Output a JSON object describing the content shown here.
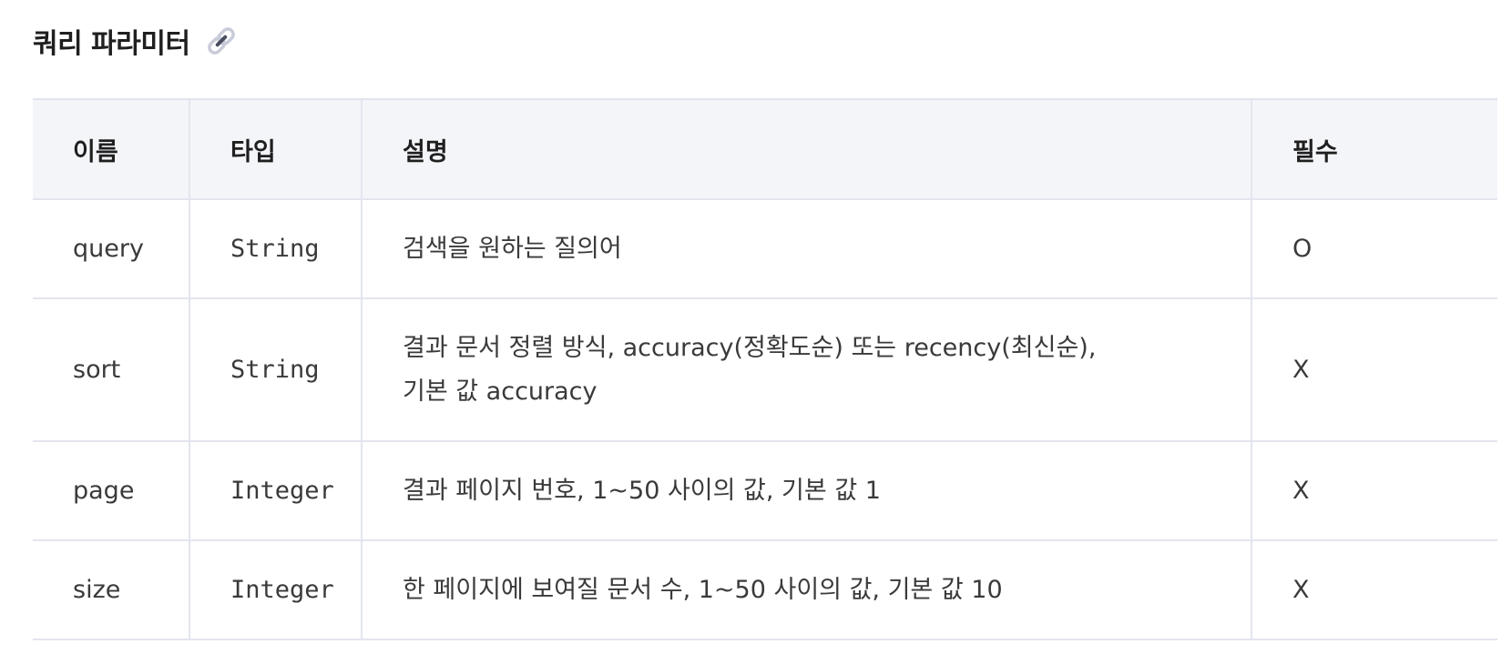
{
  "section": {
    "title": "쿼리 파라미터",
    "icon": "link-icon"
  },
  "table": {
    "headers": {
      "name": "이름",
      "type": "타입",
      "description": "설명",
      "required": "필수"
    },
    "rows": [
      {
        "name": "query",
        "type": "String",
        "description": "검색을 원하는 질의어",
        "required": "O"
      },
      {
        "name": "sort",
        "type": "String",
        "description": "결과 문서 정렬 방식, accuracy(정확도순) 또는 recency(최신순), 기본 값 accuracy",
        "required": "X"
      },
      {
        "name": "page",
        "type": "Integer",
        "description": "결과 페이지 번호, 1~50 사이의 값, 기본 값 1",
        "required": "X"
      },
      {
        "name": "size",
        "type": "Integer",
        "description": "한 페이지에 보여질 문서 수, 1~50 사이의 값, 기본 값 10",
        "required": "X"
      }
    ]
  },
  "colors": {
    "header_bg": "#f4f5f9",
    "border": "#e3e5ee",
    "icon": "#5c6078"
  }
}
